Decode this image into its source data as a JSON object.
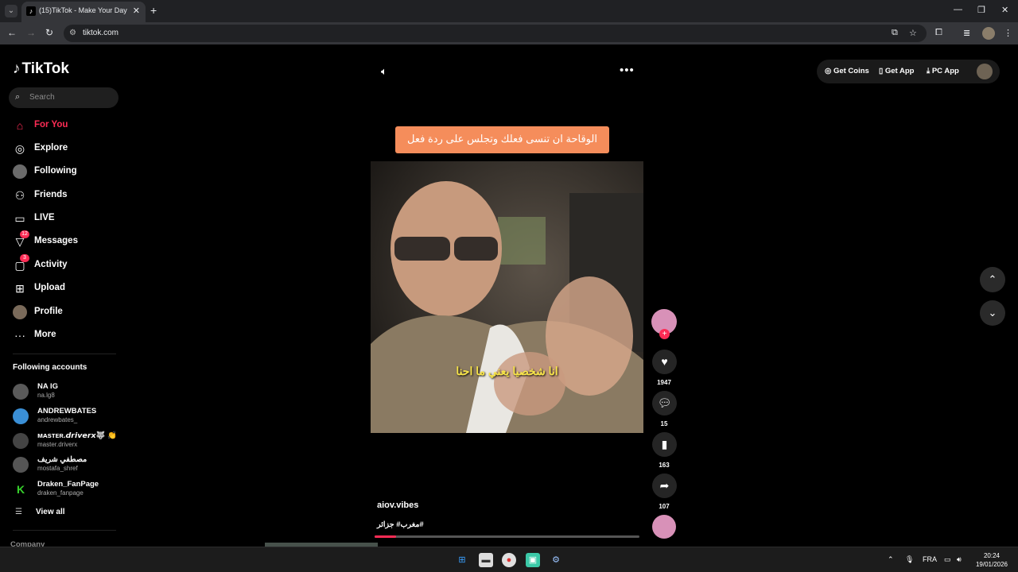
{
  "browser": {
    "tab_title": "(15)TikTok - Make Your Day",
    "url": "tiktok.com"
  },
  "sidebar": {
    "logo": "TikTok",
    "search_placeholder": "Search",
    "nav": [
      {
        "label": "For You",
        "icon": "home-icon",
        "active": true
      },
      {
        "label": "Explore",
        "icon": "compass-icon"
      },
      {
        "label": "Following",
        "icon": "following-avatar"
      },
      {
        "label": "Friends",
        "icon": "friends-icon"
      },
      {
        "label": "LIVE",
        "icon": "live-icon"
      },
      {
        "label": "Messages",
        "icon": "messages-icon",
        "badge": "12"
      },
      {
        "label": "Activity",
        "icon": "activity-icon",
        "badge": "3"
      },
      {
        "label": "Upload",
        "icon": "upload-icon"
      },
      {
        "label": "Profile",
        "icon": "profile-avatar"
      },
      {
        "label": "More",
        "icon": "more-icon"
      }
    ],
    "following_title": "Following accounts",
    "accounts": [
      {
        "name": "NA IG",
        "handle": "na.lg8"
      },
      {
        "name": "ANDREWBATES",
        "handle": "andrewbates_"
      },
      {
        "name": "ᴍᴀsᴛᴇʀ.𝙙𝙧𝙞𝙫𝙚𝙧𝙭🐺 👏",
        "handle": "master.driverx"
      },
      {
        "name": "مصطفي شريف",
        "handle": "mostafa_shref"
      },
      {
        "name": "Draken_FanPage",
        "handle": "draken_fanpage"
      }
    ],
    "view_all": "View all",
    "company": "Company"
  },
  "header": {
    "get_coins": "Get Coins",
    "get_app": "Get App",
    "pc_app": "PC App"
  },
  "video": {
    "caption_top": "الوقاحة ان تنسى فعلك وتجلس على ردة فعل",
    "subtitle": "انا شخصيا يعني ما احنا",
    "author": "aiov.vibes",
    "tags": "مغرب# جزائر#",
    "progress": 0.08
  },
  "actions": {
    "likes": "1947",
    "comments": "15",
    "saves": "163",
    "shares": "107"
  },
  "taskbar": {
    "lang": "FRA",
    "time": "20:24",
    "date": "19/01/2026"
  }
}
